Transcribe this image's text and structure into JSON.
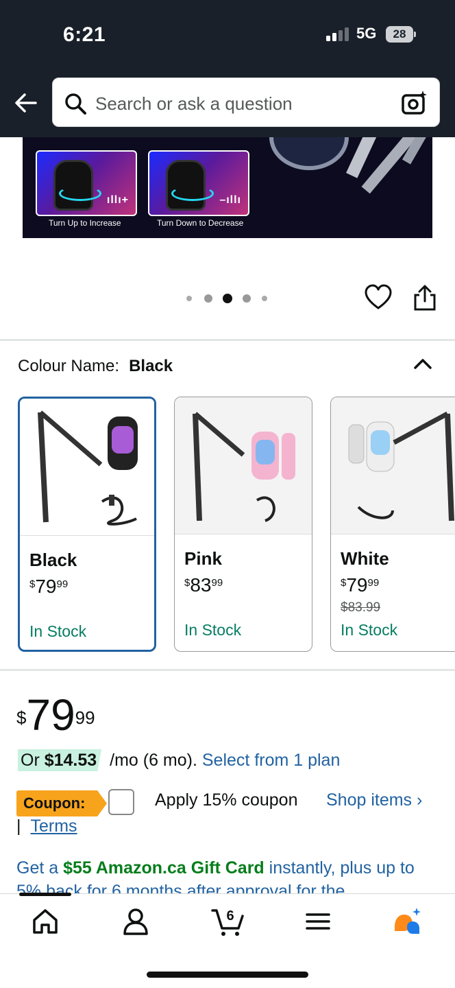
{
  "status_bar": {
    "time": "6:21",
    "network": "5G",
    "battery": "28"
  },
  "header": {
    "search_placeholder": "Search or ask a question"
  },
  "banner": {
    "captions": [
      "Turn Up to Increase",
      "Turn Down to Decrease"
    ]
  },
  "gallery": {
    "dot_count": 5,
    "active_index": 2
  },
  "colour": {
    "label": "Colour Name:",
    "selected": "Black",
    "options": [
      {
        "name": "Black",
        "price_dollars": "79",
        "price_cents": "99",
        "currency": "$",
        "list_price": "",
        "stock": "In Stock"
      },
      {
        "name": "Pink",
        "price_dollars": "83",
        "price_cents": "99",
        "currency": "$",
        "list_price": "",
        "stock": "In Stock"
      },
      {
        "name": "White",
        "price_dollars": "79",
        "price_cents": "99",
        "currency": "$",
        "list_price": "$83.99",
        "stock": "In Stock"
      }
    ]
  },
  "price": {
    "currency": "$",
    "dollars": "79",
    "cents": "99"
  },
  "financing": {
    "lead": "Or ",
    "amount": "$14.53",
    "term": " /mo (6 mo). ",
    "link": "Select from 1 plan"
  },
  "coupon": {
    "badge": "Coupon:",
    "apply": "Apply 15% coupon",
    "shop": "Shop items ›",
    "separator": "|",
    "terms": "Terms"
  },
  "promo": {
    "lead": "Get a ",
    "gift": "$55 Amazon.ca Gift Card",
    "tail": " instantly, plus up to 5% back for 6 months after approval for the"
  },
  "bottom_nav": {
    "cart_count": "6"
  },
  "colors": {
    "header_bg": "#1a202a",
    "link": "#2162a1",
    "in_stock": "#067d62",
    "selected_border": "#2162a1",
    "coupon": "#f7a31c"
  }
}
